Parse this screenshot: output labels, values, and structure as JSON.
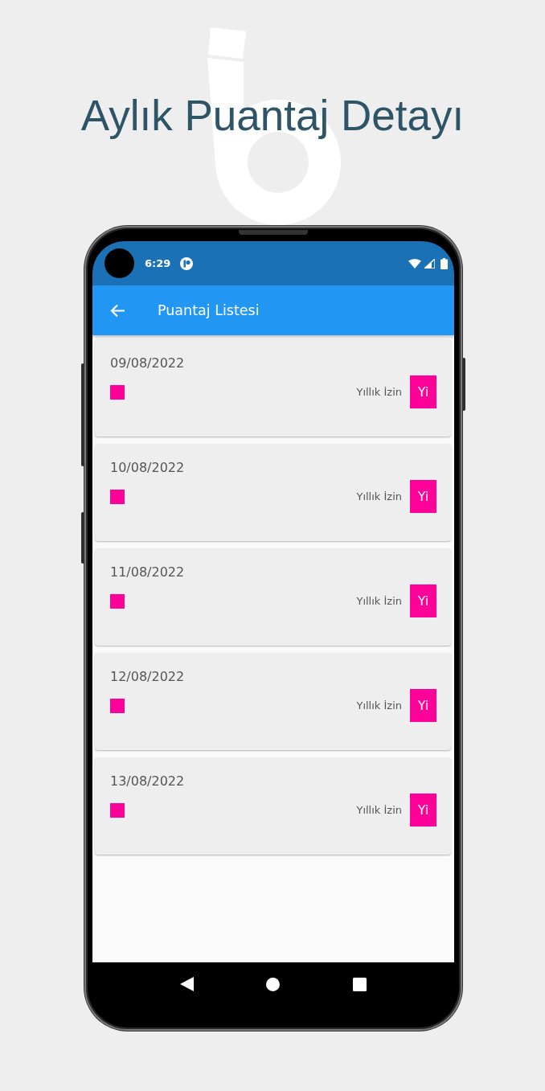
{
  "title": "Aylık Puantaj Detayı",
  "status_bar": {
    "time": "6:29"
  },
  "app_bar": {
    "title": "Puantaj Listesi"
  },
  "entries": [
    {
      "date": "09/08/2022",
      "color": "#ff0099",
      "leave_type": "Yıllık İzin",
      "code": "Yi"
    },
    {
      "date": "10/08/2022",
      "color": "#ff0099",
      "leave_type": "Yıllık İzin",
      "code": "Yi"
    },
    {
      "date": "11/08/2022",
      "color": "#ff0099",
      "leave_type": "Yıllık İzin",
      "code": "Yi"
    },
    {
      "date": "12/08/2022",
      "color": "#ff0099",
      "leave_type": "Yıllık İzin",
      "code": "Yi"
    },
    {
      "date": "13/08/2022",
      "color": "#ff0099",
      "leave_type": "Yıllık İzin",
      "code": "Yi"
    }
  ]
}
